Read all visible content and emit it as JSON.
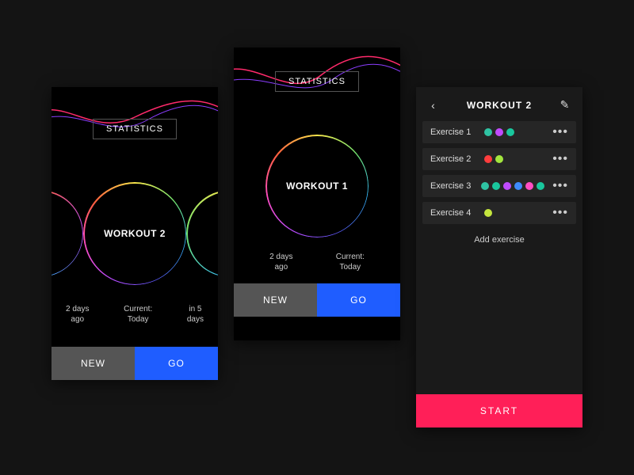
{
  "colors": {
    "blue": "#1f5dff",
    "grey": "#555555",
    "pink": "#ff1f58"
  },
  "screen_a": {
    "statistics_label": "STATISTICS",
    "workout_label": "WORKOUT 2",
    "past": "2 days\nago",
    "current": "Current:\nToday",
    "next": "in 5\ndays",
    "new_btn": "NEW",
    "go_btn": "GO"
  },
  "screen_b": {
    "statistics_label": "STATISTICS",
    "workout_label": "WORKOUT 1",
    "past": "2 days\nago",
    "current": "Current:\nToday",
    "new_btn": "NEW",
    "go_btn": "GO"
  },
  "screen_c": {
    "title": "WORKOUT 2",
    "add_exercise": "Add exercise",
    "start": "START",
    "exercises": [
      {
        "name": "Exercise 1",
        "dots": [
          "#2fc3a3",
          "#c04bff",
          "#19c79d"
        ]
      },
      {
        "name": "Exercise 2",
        "dots": [
          "#ff3d3d",
          "#a3e63e"
        ]
      },
      {
        "name": "Exercise 3",
        "dots": [
          "#2fc3a3",
          "#19c79d",
          "#c04bff",
          "#3d8bff",
          "#ff4dc4",
          "#19c79d"
        ]
      },
      {
        "name": "Exercise 4",
        "dots": [
          "#c5e63e"
        ]
      }
    ]
  }
}
